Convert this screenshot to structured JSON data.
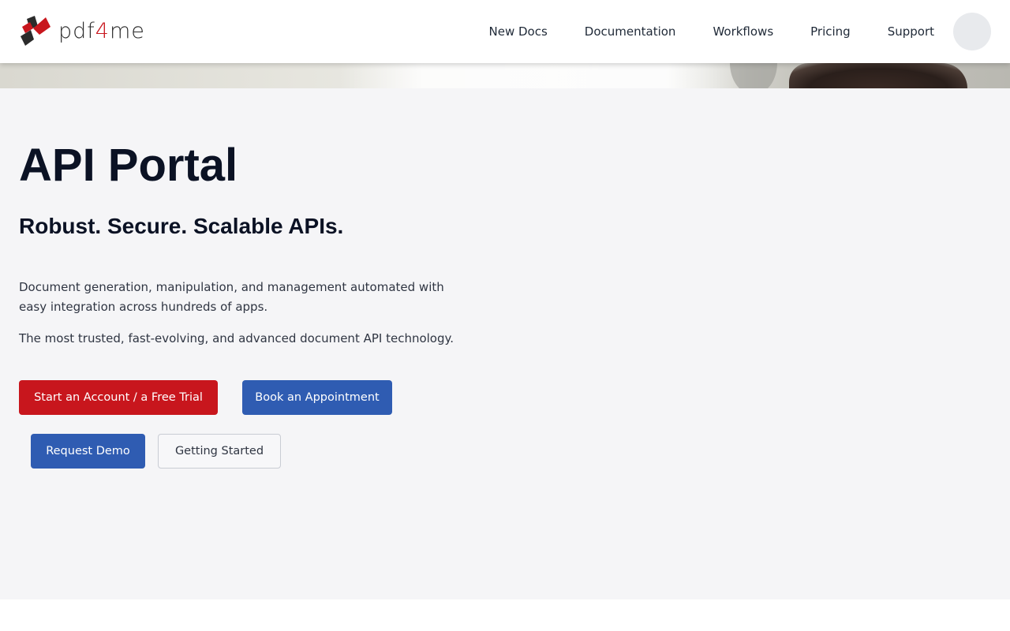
{
  "brand": {
    "name_prefix": "pdf",
    "name_accent": "4",
    "name_suffix": "me",
    "primary_color": "#c8161d",
    "secondary_color": "#2f5cb2"
  },
  "nav": {
    "items": [
      {
        "label": "New Docs"
      },
      {
        "label": "Documentation"
      },
      {
        "label": "Workflows"
      },
      {
        "label": "Pricing"
      },
      {
        "label": "Support"
      }
    ]
  },
  "hero": {
    "title": "API Portal",
    "subtitle": "Robust. Secure. Scalable APIs.",
    "description": "Document generation, manipulation, and management automated with easy integration across hundreds of apps.",
    "description2": "The most trusted, fast-evolving, and advanced document API technology.",
    "buttons": {
      "trial": "Start an Account / a Free Trial",
      "book": "Book an Appointment",
      "demo": "Request Demo",
      "getting_started": "Getting Started"
    }
  }
}
